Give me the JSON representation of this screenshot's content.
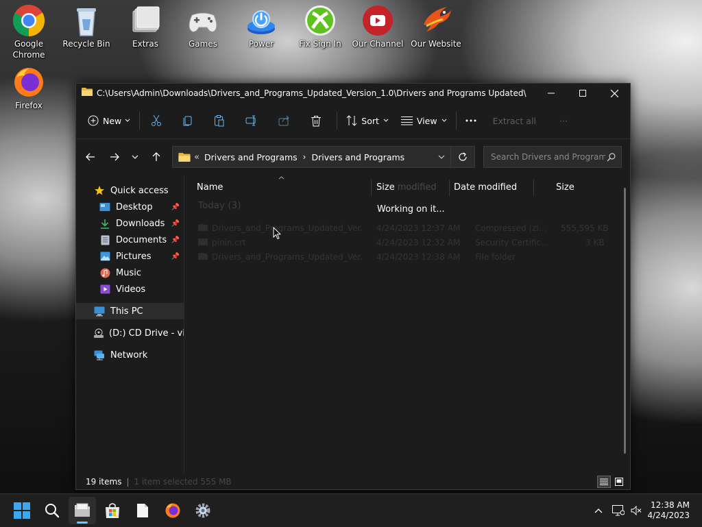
{
  "desktop": {
    "icons": [
      {
        "label": "Google Chrome",
        "icon": "chrome-icon"
      },
      {
        "label": "Recycle Bin",
        "icon": "recycle-bin-icon"
      },
      {
        "label": "Extras",
        "icon": "extras-folder-icon"
      },
      {
        "label": "Games",
        "icon": "gamepad-icon"
      },
      {
        "label": "Power",
        "icon": "power-icon"
      },
      {
        "label": "Fix Sign In",
        "icon": "xbox-icon"
      },
      {
        "label": "Our Channel",
        "icon": "youtube-icon"
      },
      {
        "label": "Our Website",
        "icon": "bird-logo-icon"
      },
      {
        "label": "Firefox",
        "icon": "firefox-icon"
      }
    ]
  },
  "window": {
    "title": "C:\\Users\\Admin\\Downloads\\Drivers_and_Programs_Updated_Version_1.0\\Drivers and Programs Updated\\",
    "controls": {
      "minimize": "—",
      "maximize": "☐",
      "close": "✕"
    },
    "toolbar": {
      "new_label": "New",
      "sort_label": "Sort",
      "view_label": "View",
      "extract_label": "Extract all",
      "more_label": "···"
    },
    "address": {
      "overflow": "«",
      "crumbs": [
        "Drivers and Programs",
        "Drivers and Programs"
      ],
      "chevron": "›",
      "search_placeholder": "Search Drivers and Programs"
    },
    "nav": {
      "quick_access": "Quick access",
      "items": [
        {
          "label": "Desktop",
          "pinned": true
        },
        {
          "label": "Downloads",
          "pinned": true
        },
        {
          "label": "Documents",
          "pinned": true
        },
        {
          "label": "Pictures",
          "pinned": true
        },
        {
          "label": "Music",
          "pinned": false
        },
        {
          "label": "Videos",
          "pinned": false
        }
      ],
      "this_pc": "This PC",
      "cd_drive": "(D:) CD Drive - virtio",
      "network": "Network"
    },
    "columns": {
      "name": "Name",
      "size": "Size",
      "size_ghost": "modified",
      "date_modified": "Date modified",
      "size_ghost2": "Size"
    },
    "group_header": "Today (3)",
    "working_text": "Working on it...",
    "rows": [
      {
        "name": "Drivers_and_Programs_Updated_Ver...",
        "date": "4/24/2023 12:37 AM",
        "type": "Compressed (zi...",
        "size": "555,595 KB"
      },
      {
        "name": "pinin.crt",
        "date": "4/24/2023 12:32 AM",
        "type": "Security Certific...",
        "size": "3 KB"
      },
      {
        "name": "Drivers_and_Programs_Updated_Ver...",
        "date": "4/24/2023 12:38 AM",
        "type": "File folder",
        "size": ""
      }
    ],
    "status": {
      "count": "19 items",
      "divider": "|",
      "selection": "1 item selected  555 MB"
    }
  },
  "taskbar": {
    "time": "12:38 AM",
    "date": "4/24/2023",
    "accent": "#60cdff"
  }
}
